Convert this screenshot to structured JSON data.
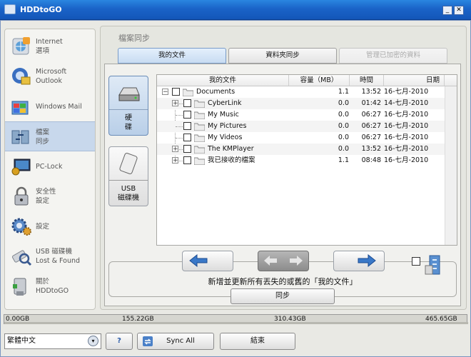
{
  "app": {
    "title": "HDDtoGO"
  },
  "sidebar": {
    "items": [
      {
        "label": "Internet\n選項",
        "icon": "globe-icon"
      },
      {
        "label": "Microsoft\nOutlook",
        "icon": "outlook-icon"
      },
      {
        "label": "Windows Mail",
        "icon": "windows-mail-icon"
      },
      {
        "label": "檔案\n同步",
        "icon": "file-sync-icon",
        "active": true
      },
      {
        "label": "PC-Lock",
        "icon": "pc-lock-icon"
      },
      {
        "label": "安全性\n設定",
        "icon": "security-lock-icon"
      },
      {
        "label": "設定",
        "icon": "settings-gear-icon"
      },
      {
        "label": "USB 磁碟機\nLost & Found",
        "icon": "usb-lost-found-icon"
      },
      {
        "label": "關於\nHDDtoGO",
        "icon": "about-icon"
      }
    ]
  },
  "main": {
    "title": "檔案同步",
    "tabs": [
      {
        "label": "我的文件"
      },
      {
        "label": "資料夾同步"
      },
      {
        "label": "管理已加密的資料"
      }
    ],
    "sources": [
      {
        "label": "硬\n碟",
        "icon": "hard-disk-icon"
      },
      {
        "label": "USB\n磁碟機",
        "icon": "usb-drive-icon"
      }
    ],
    "tree": {
      "columns": [
        "我的文件",
        "容量（MB）",
        "時間",
        "日期"
      ],
      "rows": [
        {
          "name": "Documents",
          "size": "1.1",
          "time": "13:52",
          "date": "16-七月-2010"
        },
        {
          "name": "CyberLink",
          "size": "0.0",
          "time": "01:42",
          "date": "14-七月-2010"
        },
        {
          "name": "My Music",
          "size": "0.0",
          "time": "06:27",
          "date": "16-七月-2010"
        },
        {
          "name": "My Pictures",
          "size": "0.0",
          "time": "06:27",
          "date": "16-七月-2010"
        },
        {
          "name": "My Videos",
          "size": "0.0",
          "time": "06:27",
          "date": "16-七月-2010"
        },
        {
          "name": "The KMPlayer",
          "size": "0.0",
          "time": "13:52",
          "date": "16-七月-2010"
        },
        {
          "name": "我已接收的檔案",
          "size": "1.1",
          "time": "08:48",
          "date": "16-七月-2010"
        }
      ]
    },
    "sync": {
      "message": "新增並更新所有丟失的或舊的「我的文件」",
      "button": "同步"
    }
  },
  "status": {
    "ticks": [
      "0.00GB",
      "155.22GB",
      "310.43GB",
      "465.65GB"
    ]
  },
  "bottom": {
    "language": "繁體中文",
    "help": "?",
    "sync_all": "Sync All",
    "close": "結束"
  }
}
